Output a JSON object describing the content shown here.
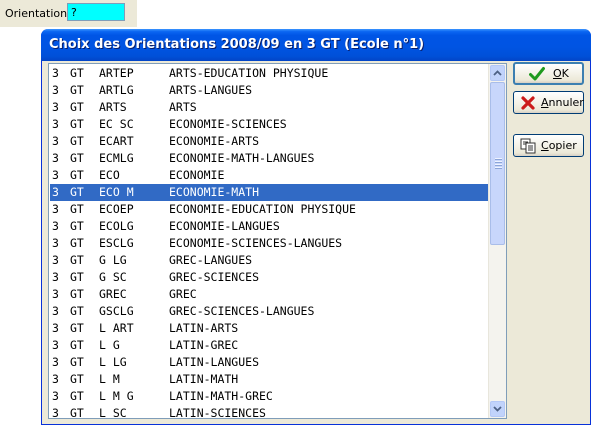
{
  "orientation_field": {
    "label": "Orientation :",
    "value": "?"
  },
  "dialog": {
    "title": "Choix des Orientations 2008/09 en 3 GT (Ecole n°1)"
  },
  "buttons": {
    "ok": {
      "hot": "O",
      "rest": "K",
      "icon": "check-icon"
    },
    "cancel": {
      "hot": "A",
      "rest": "nnuler",
      "icon": "cross-icon"
    },
    "copy": {
      "hot": "C",
      "rest": "opier",
      "icon": "copy-icon"
    }
  },
  "list": {
    "selected_index": 7,
    "rows": [
      {
        "level": "3",
        "track": "GT",
        "code": "ARTEP",
        "name": "ARTS-EDUCATION PHYSIQUE"
      },
      {
        "level": "3",
        "track": "GT",
        "code": "ARTLG",
        "name": "ARTS-LANGUES"
      },
      {
        "level": "3",
        "track": "GT",
        "code": "ARTS",
        "name": "ARTS"
      },
      {
        "level": "3",
        "track": "GT",
        "code": "EC SC",
        "name": "ECONOMIE-SCIENCES"
      },
      {
        "level": "3",
        "track": "GT",
        "code": "ECART",
        "name": "ECONOMIE-ARTS"
      },
      {
        "level": "3",
        "track": "GT",
        "code": "ECMLG",
        "name": "ECONOMIE-MATH-LANGUES"
      },
      {
        "level": "3",
        "track": "GT",
        "code": "ECO",
        "name": "ECONOMIE"
      },
      {
        "level": "3",
        "track": "GT",
        "code": "ECO M",
        "name": "ECONOMIE-MATH"
      },
      {
        "level": "3",
        "track": "GT",
        "code": "ECOEP",
        "name": "ECONOMIE-EDUCATION PHYSIQUE"
      },
      {
        "level": "3",
        "track": "GT",
        "code": "ECOLG",
        "name": "ECONOMIE-LANGUES"
      },
      {
        "level": "3",
        "track": "GT",
        "code": "ESCLG",
        "name": "ECONOMIE-SCIENCES-LANGUES"
      },
      {
        "level": "3",
        "track": "GT",
        "code": "G LG",
        "name": "GREC-LANGUES"
      },
      {
        "level": "3",
        "track": "GT",
        "code": "G SC",
        "name": "GREC-SCIENCES"
      },
      {
        "level": "3",
        "track": "GT",
        "code": "GREC",
        "name": "GREC"
      },
      {
        "level": "3",
        "track": "GT",
        "code": "GSCLG",
        "name": "GREC-SCIENCES-LANGUES"
      },
      {
        "level": "3",
        "track": "GT",
        "code": "L ART",
        "name": "LATIN-ARTS"
      },
      {
        "level": "3",
        "track": "GT",
        "code": "L G",
        "name": "LATIN-GREC"
      },
      {
        "level": "3",
        "track": "GT",
        "code": "L LG",
        "name": "LATIN-LANGUES"
      },
      {
        "level": "3",
        "track": "GT",
        "code": "L M",
        "name": "LATIN-MATH"
      },
      {
        "level": "3",
        "track": "GT",
        "code": "L M G",
        "name": "LATIN-MATH-GREC"
      },
      {
        "level": "3",
        "track": "GT",
        "code": "L SC",
        "name": "LATIN-SCIENCES"
      }
    ]
  },
  "colors": {
    "input_bg": "#00ffff",
    "title_bar": "#0054e3",
    "selection": "#316ac5",
    "dialog_bg": "#ece9d8"
  }
}
